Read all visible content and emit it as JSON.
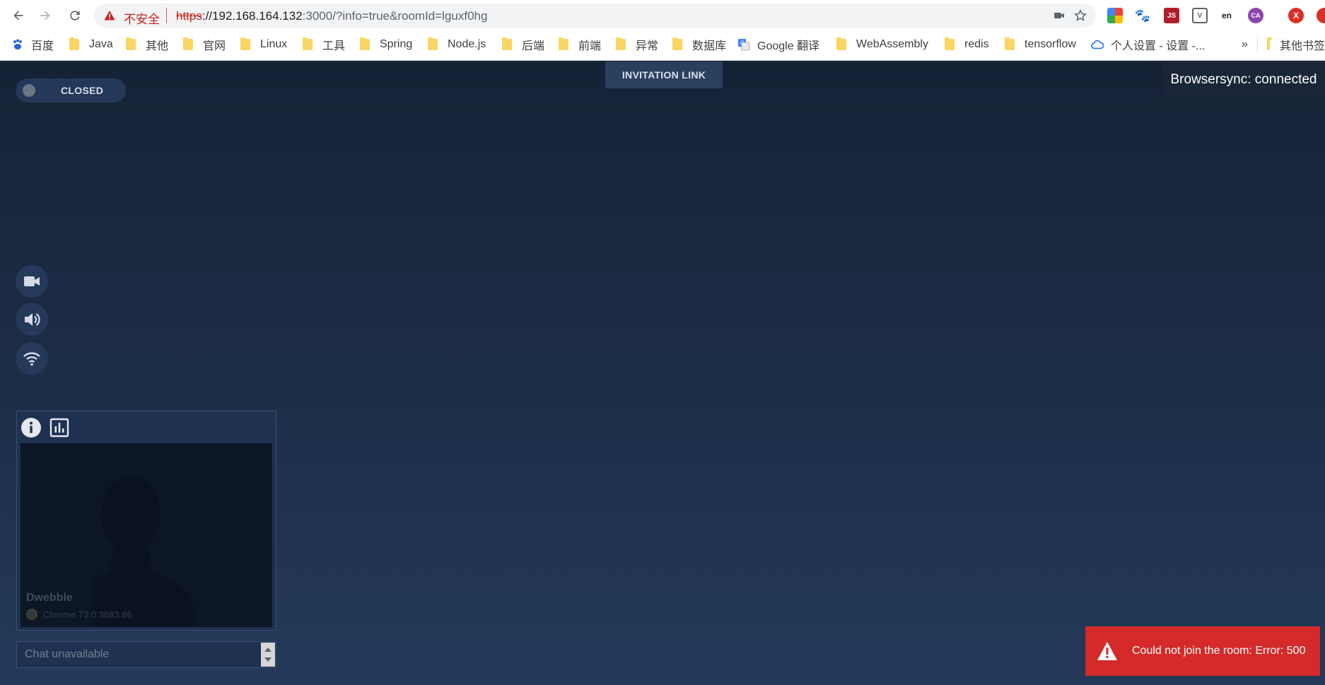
{
  "browser": {
    "insecure_label": "不安全",
    "url_scheme": "https",
    "url_host": "://192.168.164.132",
    "url_rest": ":3000/?info=true&roomId=lguxf0hg",
    "profile_initial": "X",
    "bookmarks": [
      {
        "label": "百度",
        "icon": "baidu-icon"
      },
      {
        "label": "Java",
        "icon": "folder-icon"
      },
      {
        "label": "其他",
        "icon": "folder-icon"
      },
      {
        "label": "官网",
        "icon": "folder-icon"
      },
      {
        "label": "Linux",
        "icon": "folder-icon"
      },
      {
        "label": "工具",
        "icon": "folder-icon"
      },
      {
        "label": "Spring",
        "icon": "folder-icon"
      },
      {
        "label": "Node.js",
        "icon": "folder-icon"
      },
      {
        "label": "后端",
        "icon": "folder-icon"
      },
      {
        "label": "前端",
        "icon": "folder-icon"
      },
      {
        "label": "异常",
        "icon": "folder-icon"
      },
      {
        "label": "数据库",
        "icon": "folder-icon"
      },
      {
        "label": "Google 翻译",
        "icon": "google-translate-icon"
      },
      {
        "label": "WebAssembly",
        "icon": "folder-icon"
      },
      {
        "label": "redis",
        "icon": "folder-icon"
      },
      {
        "label": "tensorflow",
        "icon": "folder-icon"
      },
      {
        "label": "个人设置 - 设置 -...",
        "icon": "cloud-icon"
      }
    ],
    "more_bookmarks": "»",
    "other_bookmarks": "其他书签"
  },
  "app": {
    "room_status": "CLOSED",
    "invitation_label": "INVITATION LINK",
    "browsersync_status": "Browsersync: connected",
    "peer": {
      "name": "Dwebble",
      "browser": "Chrome 73.0.3683.86"
    },
    "chat_placeholder": "Chat unavailable",
    "error_message": "Could not join the room: Error: 500"
  },
  "colors": {
    "error": "#d42a2a",
    "insecure": "#c5221f",
    "background_top": "#152236",
    "background_bottom": "#24395a"
  }
}
